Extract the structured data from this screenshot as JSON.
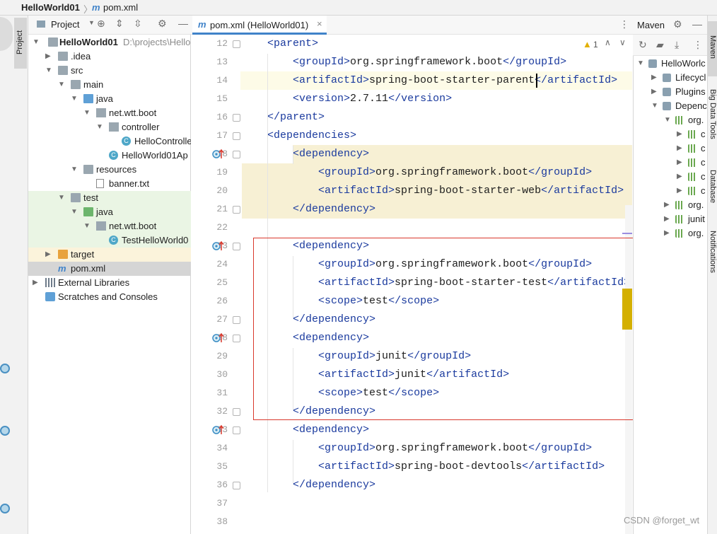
{
  "breadcrumb": {
    "project": "HelloWorld01",
    "file_icon": "m",
    "file": "pom.xml"
  },
  "left_strip": {
    "project_tab": "Project"
  },
  "project_toolbar": {
    "label": "Project"
  },
  "tree": [
    {
      "label": "HelloWorld01",
      "extra": "D:\\projects\\Hello",
      "arrow": "▼",
      "icon": "folder",
      "bold": true
    },
    {
      "label": ".idea",
      "arrow": "▶",
      "icon": "folder"
    },
    {
      "label": "src",
      "arrow": "▼",
      "icon": "folder"
    },
    {
      "label": "main",
      "arrow": "▼",
      "icon": "folder"
    },
    {
      "label": "java",
      "arrow": "▼",
      "icon": "folder-src"
    },
    {
      "label": "net.wtt.boot",
      "arrow": "▼",
      "icon": "package"
    },
    {
      "label": "controller",
      "arrow": "▼",
      "icon": "package"
    },
    {
      "label": "HelloControlle",
      "arrow": "",
      "icon": "class"
    },
    {
      "label": "HelloWorld01Ap",
      "arrow": "",
      "icon": "class"
    },
    {
      "label": "resources",
      "arrow": "▼",
      "icon": "folder-res"
    },
    {
      "label": "banner.txt",
      "arrow": "",
      "icon": "file"
    },
    {
      "label": "test",
      "arrow": "▼",
      "icon": "folder"
    },
    {
      "label": "java",
      "arrow": "▼",
      "icon": "folder-test"
    },
    {
      "label": "net.wtt.boot",
      "arrow": "▼",
      "icon": "package"
    },
    {
      "label": "TestHelloWorld0",
      "arrow": "",
      "icon": "class"
    },
    {
      "label": "target",
      "arrow": "▶",
      "icon": "folder-target"
    },
    {
      "label": "pom.xml",
      "arrow": "",
      "icon": "maven"
    },
    {
      "label": "External Libraries",
      "arrow": "▶",
      "icon": "libs"
    },
    {
      "label": "Scratches and Consoles",
      "arrow": "",
      "icon": "scratch"
    }
  ],
  "editor": {
    "tab_icon": "m",
    "tab_label": "pom.xml (HelloWorld01)",
    "tab_close": "×",
    "warning_count": "1",
    "lines": [
      {
        "n": "12",
        "indent": 1,
        "parts": [
          [
            "t",
            "<"
          ],
          [
            "n",
            "parent"
          ],
          [
            "t",
            ">"
          ]
        ]
      },
      {
        "n": "13",
        "indent": 2,
        "parts": [
          [
            "t",
            "<"
          ],
          [
            "n",
            "groupId"
          ],
          [
            "t",
            ">"
          ],
          [
            "x",
            "org.springframework.boot"
          ],
          [
            "t",
            "</"
          ],
          [
            "n",
            "groupId"
          ],
          [
            "t",
            ">"
          ]
        ]
      },
      {
        "n": "14",
        "indent": 2,
        "parts": [
          [
            "t",
            "<"
          ],
          [
            "n",
            "artifactId"
          ],
          [
            "t",
            ">"
          ],
          [
            "x",
            "spring-boot-starter-parent"
          ],
          [
            "t",
            "</"
          ],
          [
            "n",
            "artifactId"
          ],
          [
            "t",
            ">"
          ]
        ]
      },
      {
        "n": "15",
        "indent": 2,
        "parts": [
          [
            "t",
            "<"
          ],
          [
            "n",
            "version"
          ],
          [
            "t",
            ">"
          ],
          [
            "x",
            "2.7.11"
          ],
          [
            "t",
            "</"
          ],
          [
            "n",
            "version"
          ],
          [
            "t",
            ">"
          ]
        ]
      },
      {
        "n": "16",
        "indent": 1,
        "parts": [
          [
            "t",
            "</"
          ],
          [
            "n",
            "parent"
          ],
          [
            "t",
            ">"
          ]
        ]
      },
      {
        "n": "17",
        "indent": 1,
        "parts": [
          [
            "t",
            "<"
          ],
          [
            "n",
            "dependencies"
          ],
          [
            "t",
            ">"
          ]
        ]
      },
      {
        "n": "18",
        "indent": 2,
        "parts": [
          [
            "t",
            "<"
          ],
          [
            "n",
            "dependency"
          ],
          [
            "t",
            ">"
          ]
        ]
      },
      {
        "n": "19",
        "indent": 3,
        "parts": [
          [
            "t",
            "<"
          ],
          [
            "n",
            "groupId"
          ],
          [
            "t",
            ">"
          ],
          [
            "x",
            "org.springframework.boot"
          ],
          [
            "t",
            "</"
          ],
          [
            "n",
            "groupId"
          ],
          [
            "t",
            ">"
          ]
        ]
      },
      {
        "n": "20",
        "indent": 3,
        "parts": [
          [
            "t",
            "<"
          ],
          [
            "n",
            "artifactId"
          ],
          [
            "t",
            ">"
          ],
          [
            "x",
            "spring-boot-starter-web"
          ],
          [
            "t",
            "</"
          ],
          [
            "n",
            "artifactId"
          ],
          [
            "t",
            ">"
          ]
        ]
      },
      {
        "n": "21",
        "indent": 2,
        "parts": [
          [
            "t",
            "</"
          ],
          [
            "n",
            "dependency"
          ],
          [
            "t",
            ">"
          ]
        ]
      },
      {
        "n": "22",
        "indent": 0,
        "parts": []
      },
      {
        "n": "23",
        "indent": 2,
        "parts": [
          [
            "t",
            "<"
          ],
          [
            "n",
            "dependency"
          ],
          [
            "t",
            ">"
          ]
        ]
      },
      {
        "n": "24",
        "indent": 3,
        "parts": [
          [
            "t",
            "<"
          ],
          [
            "n",
            "groupId"
          ],
          [
            "t",
            ">"
          ],
          [
            "x",
            "org.springframework.boot"
          ],
          [
            "t",
            "</"
          ],
          [
            "n",
            "groupId"
          ],
          [
            "t",
            ">"
          ]
        ]
      },
      {
        "n": "25",
        "indent": 3,
        "parts": [
          [
            "t",
            "<"
          ],
          [
            "n",
            "artifactId"
          ],
          [
            "t",
            ">"
          ],
          [
            "x",
            "spring-boot-starter-test"
          ],
          [
            "t",
            "</"
          ],
          [
            "n",
            "artifactId"
          ],
          [
            "t",
            ">"
          ]
        ]
      },
      {
        "n": "26",
        "indent": 3,
        "parts": [
          [
            "t",
            "<"
          ],
          [
            "n",
            "scope"
          ],
          [
            "t",
            ">"
          ],
          [
            "x",
            "test"
          ],
          [
            "t",
            "</"
          ],
          [
            "n",
            "scope"
          ],
          [
            "t",
            ">"
          ]
        ]
      },
      {
        "n": "27",
        "indent": 2,
        "parts": [
          [
            "t",
            "</"
          ],
          [
            "n",
            "dependency"
          ],
          [
            "t",
            ">"
          ]
        ]
      },
      {
        "n": "28",
        "indent": 2,
        "parts": [
          [
            "t",
            "<"
          ],
          [
            "n",
            "dependency"
          ],
          [
            "t",
            ">"
          ]
        ]
      },
      {
        "n": "29",
        "indent": 3,
        "parts": [
          [
            "t",
            "<"
          ],
          [
            "n",
            "groupId"
          ],
          [
            "t",
            ">"
          ],
          [
            "x",
            "junit"
          ],
          [
            "t",
            "</"
          ],
          [
            "n",
            "groupId"
          ],
          [
            "t",
            ">"
          ]
        ]
      },
      {
        "n": "30",
        "indent": 3,
        "parts": [
          [
            "t",
            "<"
          ],
          [
            "n",
            "artifactId"
          ],
          [
            "t",
            ">"
          ],
          [
            "x",
            "junit"
          ],
          [
            "t",
            "</"
          ],
          [
            "n",
            "artifactId"
          ],
          [
            "t",
            ">"
          ]
        ]
      },
      {
        "n": "31",
        "indent": 3,
        "parts": [
          [
            "t",
            "<"
          ],
          [
            "n",
            "scope"
          ],
          [
            "t",
            ">"
          ],
          [
            "x",
            "test"
          ],
          [
            "t",
            "</"
          ],
          [
            "n",
            "scope"
          ],
          [
            "t",
            ">"
          ]
        ]
      },
      {
        "n": "32",
        "indent": 2,
        "parts": [
          [
            "t",
            "</"
          ],
          [
            "n",
            "dependency"
          ],
          [
            "t",
            ">"
          ]
        ]
      },
      {
        "n": "33",
        "indent": 2,
        "parts": [
          [
            "t",
            "<"
          ],
          [
            "n",
            "dependency"
          ],
          [
            "t",
            ">"
          ]
        ]
      },
      {
        "n": "34",
        "indent": 3,
        "parts": [
          [
            "t",
            "<"
          ],
          [
            "n",
            "groupId"
          ],
          [
            "t",
            ">"
          ],
          [
            "x",
            "org.springframework.boot"
          ],
          [
            "t",
            "</"
          ],
          [
            "n",
            "groupId"
          ],
          [
            "t",
            ">"
          ]
        ]
      },
      {
        "n": "35",
        "indent": 3,
        "parts": [
          [
            "t",
            "<"
          ],
          [
            "n",
            "artifactId"
          ],
          [
            "t",
            ">"
          ],
          [
            "x",
            "spring-boot-devtools"
          ],
          [
            "t",
            "</"
          ],
          [
            "n",
            "artifactId"
          ],
          [
            "t",
            ">"
          ]
        ]
      },
      {
        "n": "36",
        "indent": 2,
        "parts": [
          [
            "t",
            "</"
          ],
          [
            "n",
            "dependency"
          ],
          [
            "t",
            ">"
          ]
        ]
      },
      {
        "n": "37",
        "indent": 0,
        "parts": []
      },
      {
        "n": "38",
        "indent": 0,
        "parts": []
      }
    ]
  },
  "maven": {
    "title": "Maven",
    "rows": [
      {
        "label": "HelloWorlc",
        "arrow": "▼"
      },
      {
        "label": "Lifecycl",
        "arrow": "▶"
      },
      {
        "label": "Plugins",
        "arrow": "▶"
      },
      {
        "label": "Depenc",
        "arrow": "▼"
      },
      {
        "label": "org.",
        "arrow": "▼"
      },
      {
        "label": "c",
        "arrow": "▶"
      },
      {
        "label": "c",
        "arrow": "▶"
      },
      {
        "label": "c",
        "arrow": "▶"
      },
      {
        "label": "c",
        "arrow": "▶"
      },
      {
        "label": "c",
        "arrow": "▶"
      },
      {
        "label": "org.",
        "arrow": "▶"
      },
      {
        "label": "junit",
        "arrow": "▶"
      },
      {
        "label": "org.",
        "arrow": "▶"
      }
    ]
  },
  "right_strip": {
    "maven_tab": "Maven",
    "bigdata_tab": "Big Data Tools",
    "database_tab": "Database",
    "notifications_tab": "Notifications"
  },
  "watermark": "CSDN @forget_wt",
  "colors": {
    "tag": "#1a3a9e",
    "highlight": "#f7f0d4",
    "redbox": "#d9382c",
    "selection": "#d5d5d5"
  }
}
